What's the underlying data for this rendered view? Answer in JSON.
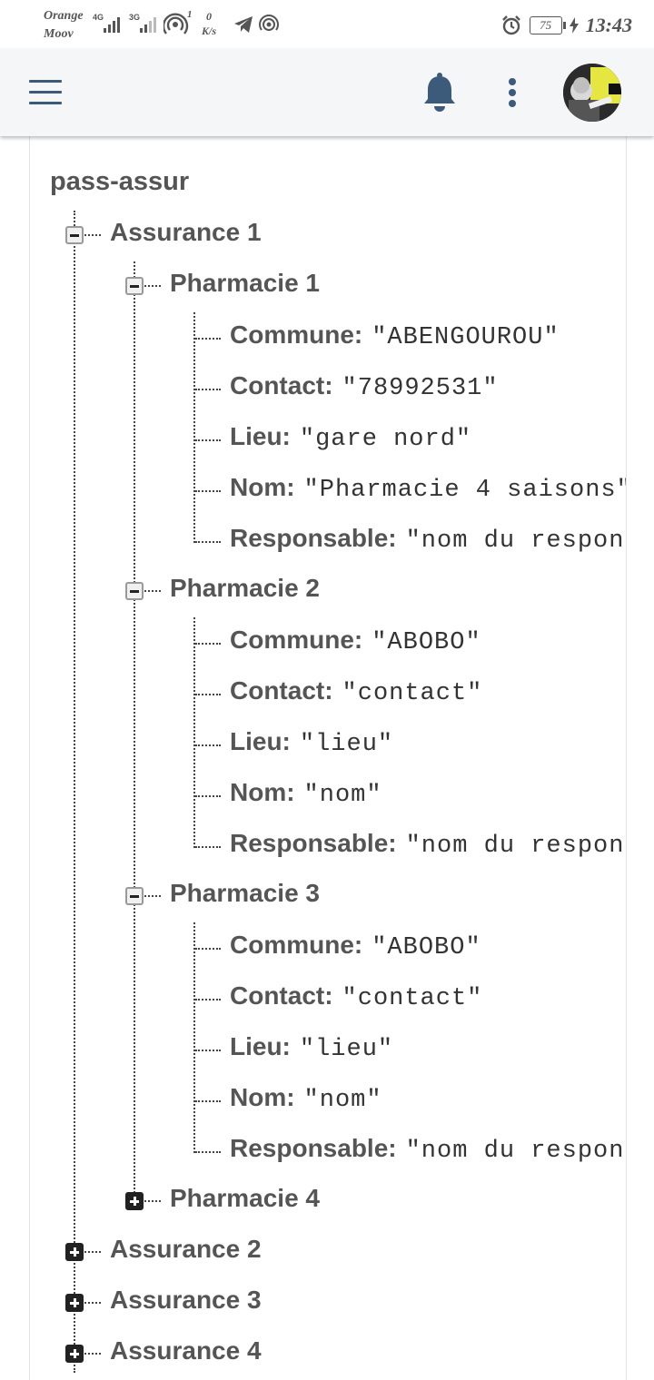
{
  "status_bar": {
    "carrier_1": "Orange",
    "carrier_2": "Moov",
    "net_1": "4G",
    "net_2": "3G",
    "hotspot_count": "1",
    "speed_value": "0",
    "speed_unit": "K/s",
    "battery": "75",
    "time": "13:43"
  },
  "app_bar": {
    "icons": [
      "menu-icon",
      "bell-icon",
      "more-vert-icon"
    ],
    "accent_color": "#3c5a7a"
  },
  "tree": {
    "root": "pass-assur",
    "assurances": [
      {
        "label": "Assurance 1",
        "expanded": true,
        "pharmacies": [
          {
            "label": "Pharmacie 1",
            "expanded": true,
            "fields": [
              {
                "key": "Commune:",
                "value": "\"ABENGOUROU\""
              },
              {
                "key": "Contact:",
                "value": "\"78992531\""
              },
              {
                "key": "Lieu:",
                "value": "\"gare nord\""
              },
              {
                "key": "Nom:",
                "value": "\"Pharmacie 4 saisons\""
              },
              {
                "key": "Responsable:",
                "value": "\"nom du responsable\""
              }
            ]
          },
          {
            "label": "Pharmacie 2",
            "expanded": true,
            "fields": [
              {
                "key": "Commune:",
                "value": "\"ABOBO\""
              },
              {
                "key": "Contact:",
                "value": "\"contact\""
              },
              {
                "key": "Lieu:",
                "value": "\"lieu\""
              },
              {
                "key": "Nom:",
                "value": "\"nom\""
              },
              {
                "key": "Responsable:",
                "value": "\"nom du responsable\""
              }
            ]
          },
          {
            "label": "Pharmacie 3",
            "expanded": true,
            "fields": [
              {
                "key": "Commune:",
                "value": "\"ABOBO\""
              },
              {
                "key": "Contact:",
                "value": "\"contact\""
              },
              {
                "key": "Lieu:",
                "value": "\"lieu\""
              },
              {
                "key": "Nom:",
                "value": "\"nom\""
              },
              {
                "key": "Responsable:",
                "value": "\"nom du responsable\""
              }
            ]
          },
          {
            "label": "Pharmacie 4",
            "expanded": false
          }
        ]
      },
      {
        "label": "Assurance 2",
        "expanded": false
      },
      {
        "label": "Assurance 3",
        "expanded": false
      },
      {
        "label": "Assurance 4",
        "expanded": false
      }
    ]
  }
}
